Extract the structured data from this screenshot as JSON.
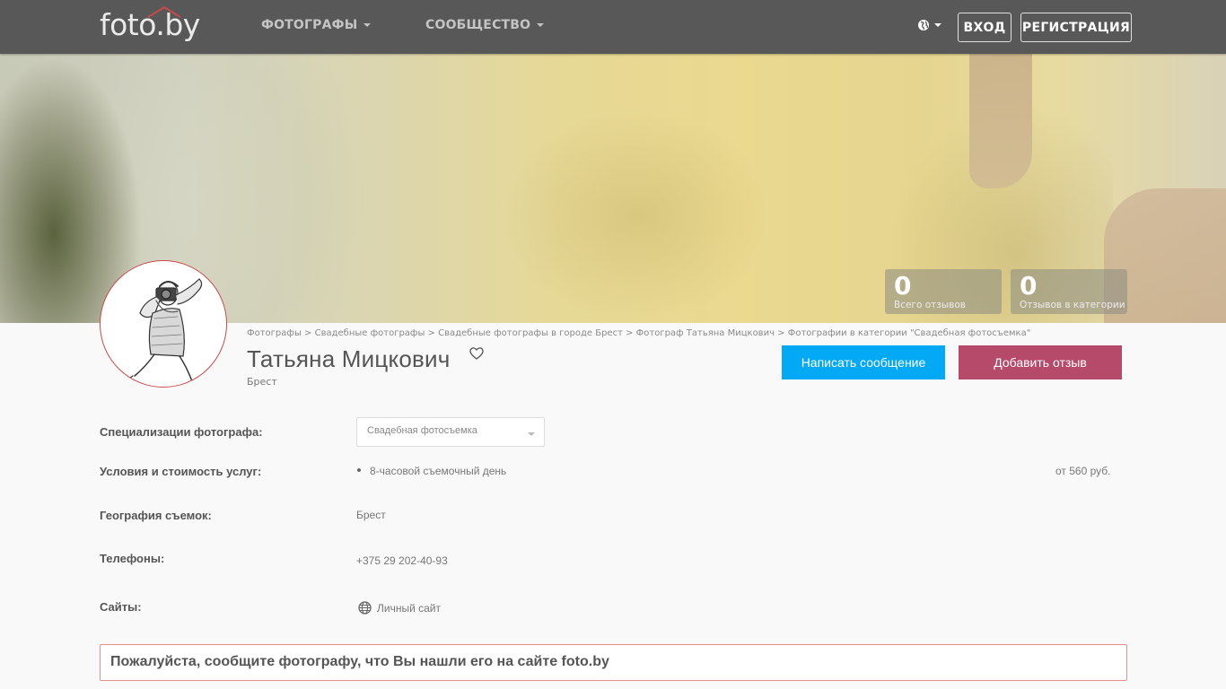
{
  "header": {
    "logo_text": "foto.by",
    "menu": [
      {
        "label": "ФОТОГРАФЫ"
      },
      {
        "label": "СООБЩЕСТВО"
      }
    ],
    "login_label": "ВХОД",
    "register_label": "РЕГИСТРАЦИЯ"
  },
  "stats": [
    {
      "value": "0",
      "label": "Всего отзывов"
    },
    {
      "value": "0",
      "label": "Отзывов в категории"
    }
  ],
  "breadcrumb": "Фотографы > Свадебные фотографы > Свадебные фотографы в городе Брест > Фотограф Татьяна Мицкович > Фотографии в категории \"Свадебная фотосъемка\"",
  "profile": {
    "name": "Татьяна Мицкович",
    "city": "Брест"
  },
  "actions": {
    "message_label": "Написать сообщение",
    "review_label": "Добавить отзыв"
  },
  "details": {
    "specialization_label": "Специализации фотографа:",
    "specialization_value": "Свадебная фотосъемка",
    "services_label": "Условия и стоимость услуг:",
    "service_item": "8-часовой съемочный день",
    "service_price": "от 560 руб.",
    "geography_label": "География съемок:",
    "geography_value": "Брест",
    "phones_label": "Телефоны:",
    "phone_value": "+375 29 202-40-93",
    "sites_label": "Сайты:",
    "site_value": "Личный сайт"
  },
  "notice": "Пожалуйста, сообщите фотографу, что Вы нашли его на сайте foto.by",
  "colors": {
    "header_bg": "#585858",
    "message_btn": "#03a9f4",
    "review_btn": "#b54a6b",
    "notice_border": "#e58f8f"
  }
}
